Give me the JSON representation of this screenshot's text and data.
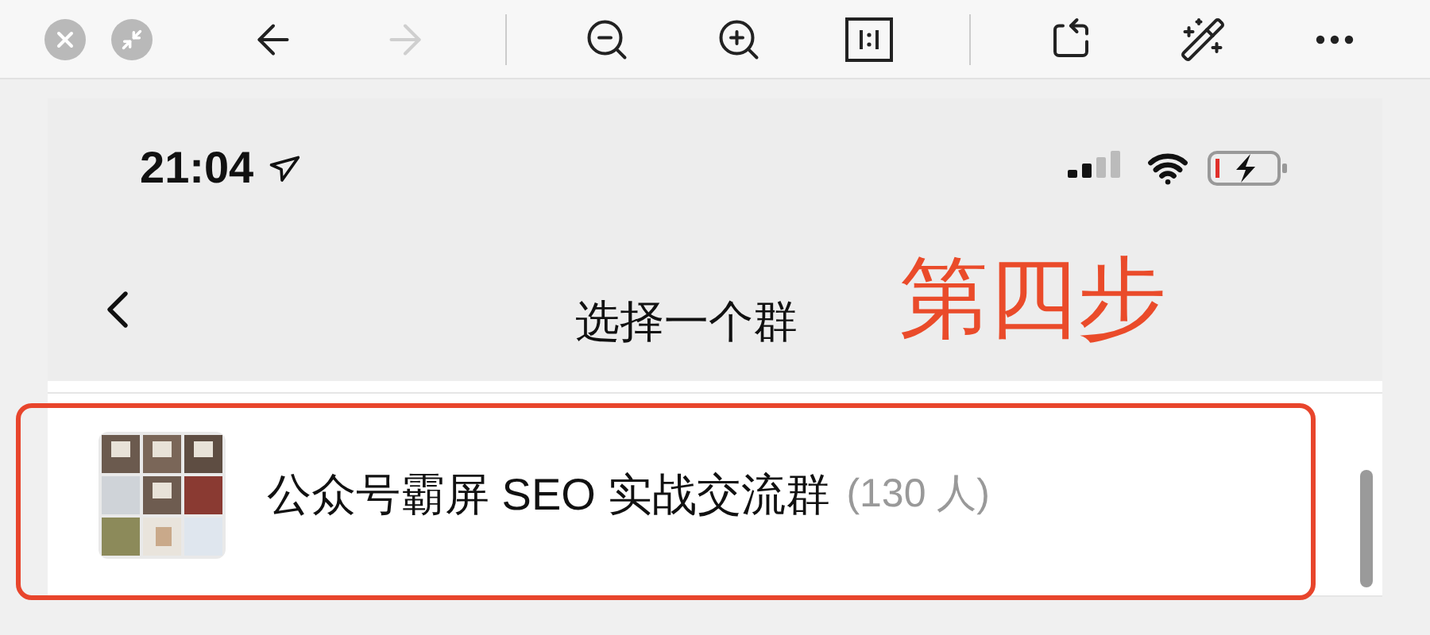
{
  "toolbar": {
    "buttons": [
      {
        "kind": "back",
        "disabled": false
      },
      {
        "kind": "forward",
        "disabled": true
      },
      {
        "kind": "zoom-out",
        "disabled": false
      },
      {
        "kind": "zoom-in",
        "disabled": false
      },
      {
        "kind": "actual-size",
        "disabled": false
      },
      {
        "kind": "rotate",
        "disabled": false
      },
      {
        "kind": "enhance",
        "disabled": false
      },
      {
        "kind": "more",
        "disabled": false
      }
    ]
  },
  "status_bar": {
    "time": "21:04"
  },
  "nav_bar": {
    "title": "选择一个群",
    "annotation": "第四步"
  },
  "groups": [
    {
      "name": "公众号霸屏 SEO 实战交流群",
      "count": "(130 人)",
      "highlighted": true
    }
  ]
}
